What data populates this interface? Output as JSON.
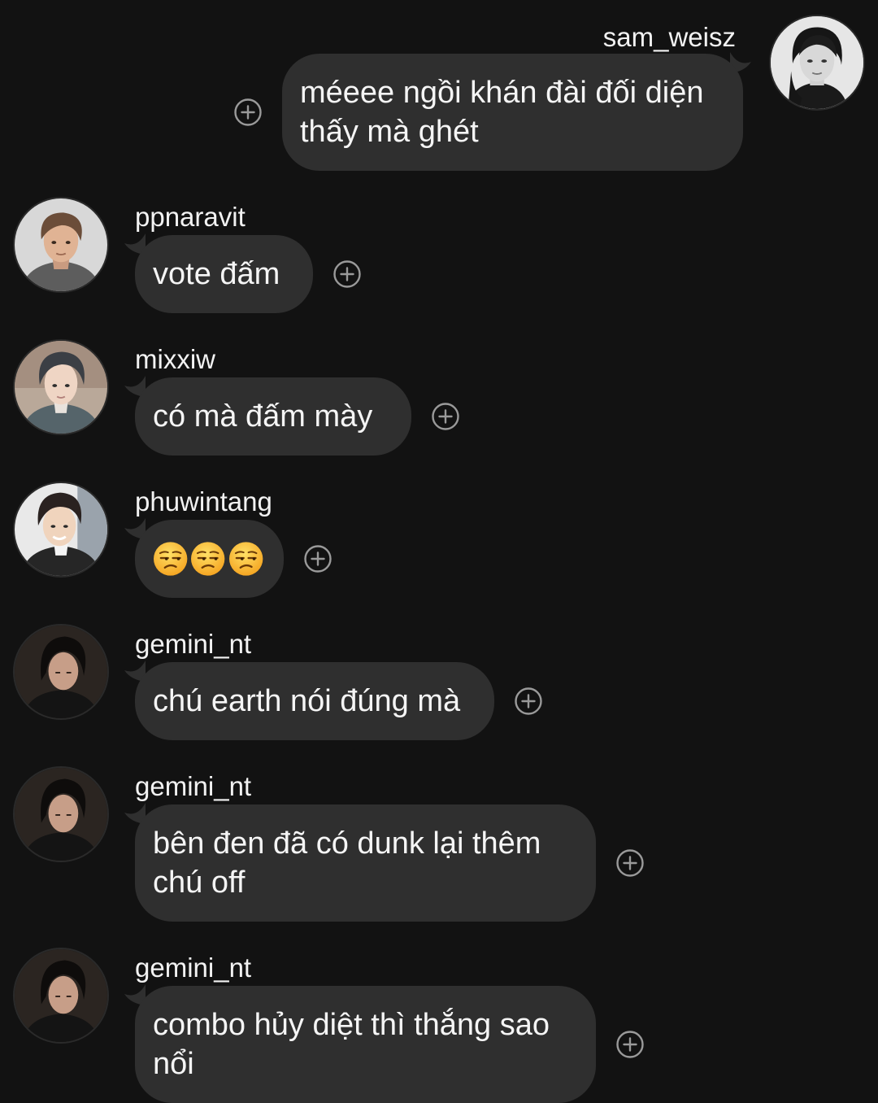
{
  "messages": [
    {
      "username": "sam_weisz",
      "text": "méeee ngồi khán đài đối diện thấy mà ghét",
      "side": "right",
      "avatar_icon": "woman-portrait-avatar"
    },
    {
      "username": "ppnaravit",
      "text": "vote đấm",
      "side": "left",
      "avatar_icon": "man-portrait-avatar"
    },
    {
      "username": "mixxiw",
      "text": "có mà đấm mày",
      "side": "left",
      "avatar_icon": "man-portrait-avatar"
    },
    {
      "username": "phuwintang",
      "text": "😒😒😒",
      "side": "left",
      "avatar_icon": "man-portrait-avatar"
    },
    {
      "username": "gemini_nt",
      "text": "chú earth nói đúng mà",
      "side": "left",
      "avatar_icon": "man-portrait-avatar"
    },
    {
      "username": "gemini_nt",
      "text": "bên đen đã có dunk lại thêm chú off",
      "side": "left",
      "avatar_icon": "man-portrait-avatar"
    },
    {
      "username": "gemini_nt",
      "text": "combo hủy diệt thì thắng sao nổi",
      "side": "left",
      "avatar_icon": "man-portrait-avatar"
    }
  ],
  "icons": {
    "reaction": "add-reaction-icon",
    "emoji": "unamused-face-emoji"
  },
  "colors": {
    "background": "#121212",
    "bubble": "#2f2f2f",
    "text": "#f5f5f5",
    "icon": "#9a9a9a"
  }
}
